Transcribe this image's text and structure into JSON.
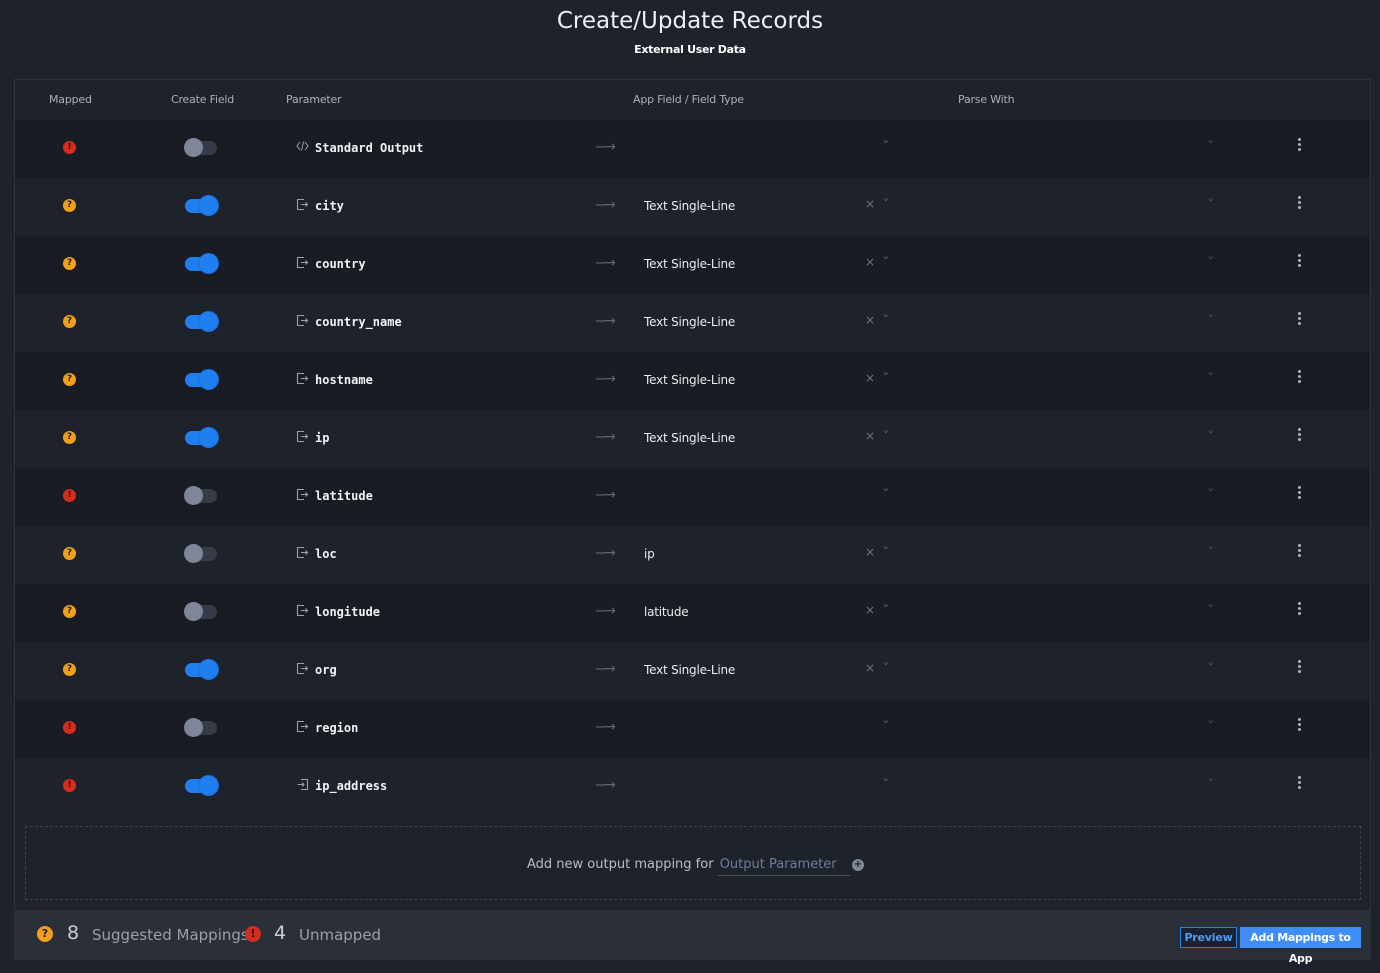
{
  "header": {
    "title": "Create/Update Records",
    "subtitle": "External User Data"
  },
  "columns": {
    "mapped": "Mapped",
    "create_field": "Create Field",
    "parameter": "Parameter",
    "app_field": "App Field / Field Type",
    "parse_with": "Parse With"
  },
  "rows": [
    {
      "status": "error",
      "status_glyph": "!",
      "create_field": false,
      "param_icon": "code-icon",
      "param": "Standard Output",
      "field": "",
      "clearable": false
    },
    {
      "status": "warning",
      "status_glyph": "?",
      "create_field": true,
      "param_icon": "output-icon",
      "param": "city",
      "field": "Text Single-Line",
      "clearable": true
    },
    {
      "status": "warning",
      "status_glyph": "?",
      "create_field": true,
      "param_icon": "output-icon",
      "param": "country",
      "field": "Text Single-Line",
      "clearable": true
    },
    {
      "status": "warning",
      "status_glyph": "?",
      "create_field": true,
      "param_icon": "output-icon",
      "param": "country_name",
      "field": "Text Single-Line",
      "clearable": true
    },
    {
      "status": "warning",
      "status_glyph": "?",
      "create_field": true,
      "param_icon": "output-icon",
      "param": "hostname",
      "field": "Text Single-Line",
      "clearable": true
    },
    {
      "status": "warning",
      "status_glyph": "?",
      "create_field": true,
      "param_icon": "output-icon",
      "param": "ip",
      "field": "Text Single-Line",
      "clearable": true
    },
    {
      "status": "error",
      "status_glyph": "!",
      "create_field": false,
      "param_icon": "output-icon",
      "param": "latitude",
      "field": "",
      "clearable": false
    },
    {
      "status": "warning",
      "status_glyph": "?",
      "create_field": false,
      "param_icon": "output-icon",
      "param": "loc",
      "field": "ip",
      "clearable": true
    },
    {
      "status": "warning",
      "status_glyph": "?",
      "create_field": false,
      "param_icon": "output-icon",
      "param": "longitude",
      "field": "latitude",
      "clearable": true
    },
    {
      "status": "warning",
      "status_glyph": "?",
      "create_field": true,
      "param_icon": "output-icon",
      "param": "org",
      "field": "Text Single-Line",
      "clearable": true
    },
    {
      "status": "error",
      "status_glyph": "!",
      "create_field": false,
      "param_icon": "output-icon",
      "param": "region",
      "field": "",
      "clearable": false
    },
    {
      "status": "error",
      "status_glyph": "!",
      "create_field": true,
      "param_icon": "input-icon",
      "param": "ip_address",
      "field": "",
      "clearable": false
    }
  ],
  "add_mapping": {
    "label": "Add new output mapping for",
    "placeholder": "Output Parameter"
  },
  "footer": {
    "suggested_count": "8",
    "suggested_label": "Suggested Mappings",
    "unmapped_count": "4",
    "unmapped_label": "Unmapped",
    "suggested_glyph": "?",
    "unmapped_glyph": "!",
    "preview_label": "Preview",
    "add_label": "Add Mappings to App"
  },
  "colors": {
    "background": "#1e222a",
    "row_alt": "#191c23",
    "accent_blue": "#1f7ff0",
    "warning": "#f29f1c",
    "error": "#d42e1f"
  }
}
